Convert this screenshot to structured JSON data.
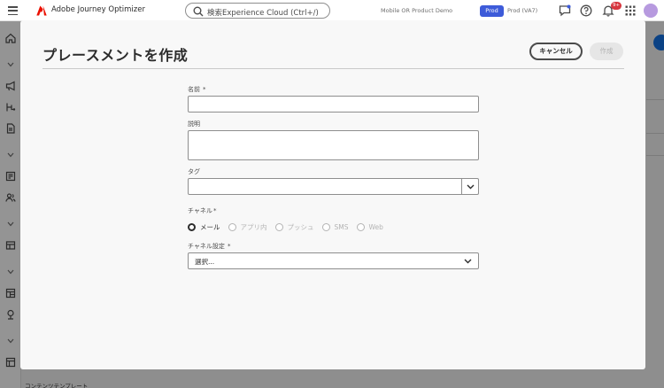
{
  "header": {
    "app_name": "Adobe Journey Optimizer",
    "search_placeholder": "検索Experience Cloud (Ctrl+/)",
    "org_name": "Mobile OR Product Demo",
    "sandbox_badge": "Prod",
    "sandbox_name": "Prod (VA7)",
    "notification_count": "9+"
  },
  "background": {
    "bottom_label": "コンテンツテンプレート"
  },
  "dialog": {
    "title": "プレースメントを作成",
    "cancel_label": "キャンセル",
    "create_label": "作成",
    "fields": {
      "name_label": "名前",
      "description_label": "説明",
      "tags_label": "タグ",
      "channel_label": "チャネル",
      "channel_config_label": "チャネル設定",
      "required_marker": "*",
      "channel_config_placeholder": "選択..."
    },
    "channels": [
      {
        "label": "メール",
        "selected": true
      },
      {
        "label": "アプリ内",
        "selected": false
      },
      {
        "label": "プッシュ",
        "selected": false
      },
      {
        "label": "SMS",
        "selected": false
      },
      {
        "label": "Web",
        "selected": false
      }
    ]
  },
  "colors": {
    "accent": "#3d5bd9",
    "brand_red": "#eb1000",
    "badge_red": "#d7373f",
    "link_blue": "#1473e6"
  },
  "icons": {
    "app_logo": "adobe-logo-icon",
    "search": "search-icon",
    "feedback": "chat-icon",
    "help": "help-icon",
    "notifications": "bell-icon",
    "apps": "app-grid-icon"
  }
}
